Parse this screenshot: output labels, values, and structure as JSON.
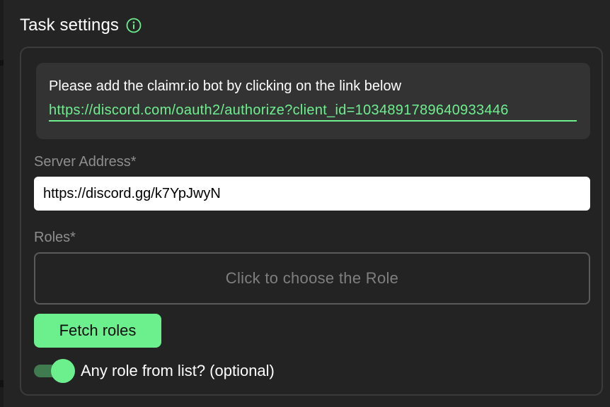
{
  "header": {
    "title": "Task settings",
    "info_icon": "info-circle-icon"
  },
  "notice": {
    "text": "Please add the claimr.io bot by clicking on the link below",
    "link_text": "https://discord.com/oauth2/authorize?client_id=1034891789640933446"
  },
  "server": {
    "label": "Server Address*",
    "value": "https://discord.gg/k7YpJwyN"
  },
  "roles": {
    "label": "Roles*",
    "placeholder": "Click to choose the Role"
  },
  "fetch_button": {
    "label": "Fetch roles"
  },
  "any_role_toggle": {
    "label": "Any role from list? (optional)",
    "checked": true
  },
  "colors": {
    "accent": "#6cf08d",
    "background": "#242424",
    "card_border": "#3b3b3b",
    "notice_bg": "#333333",
    "label": "#8e8e8e"
  }
}
